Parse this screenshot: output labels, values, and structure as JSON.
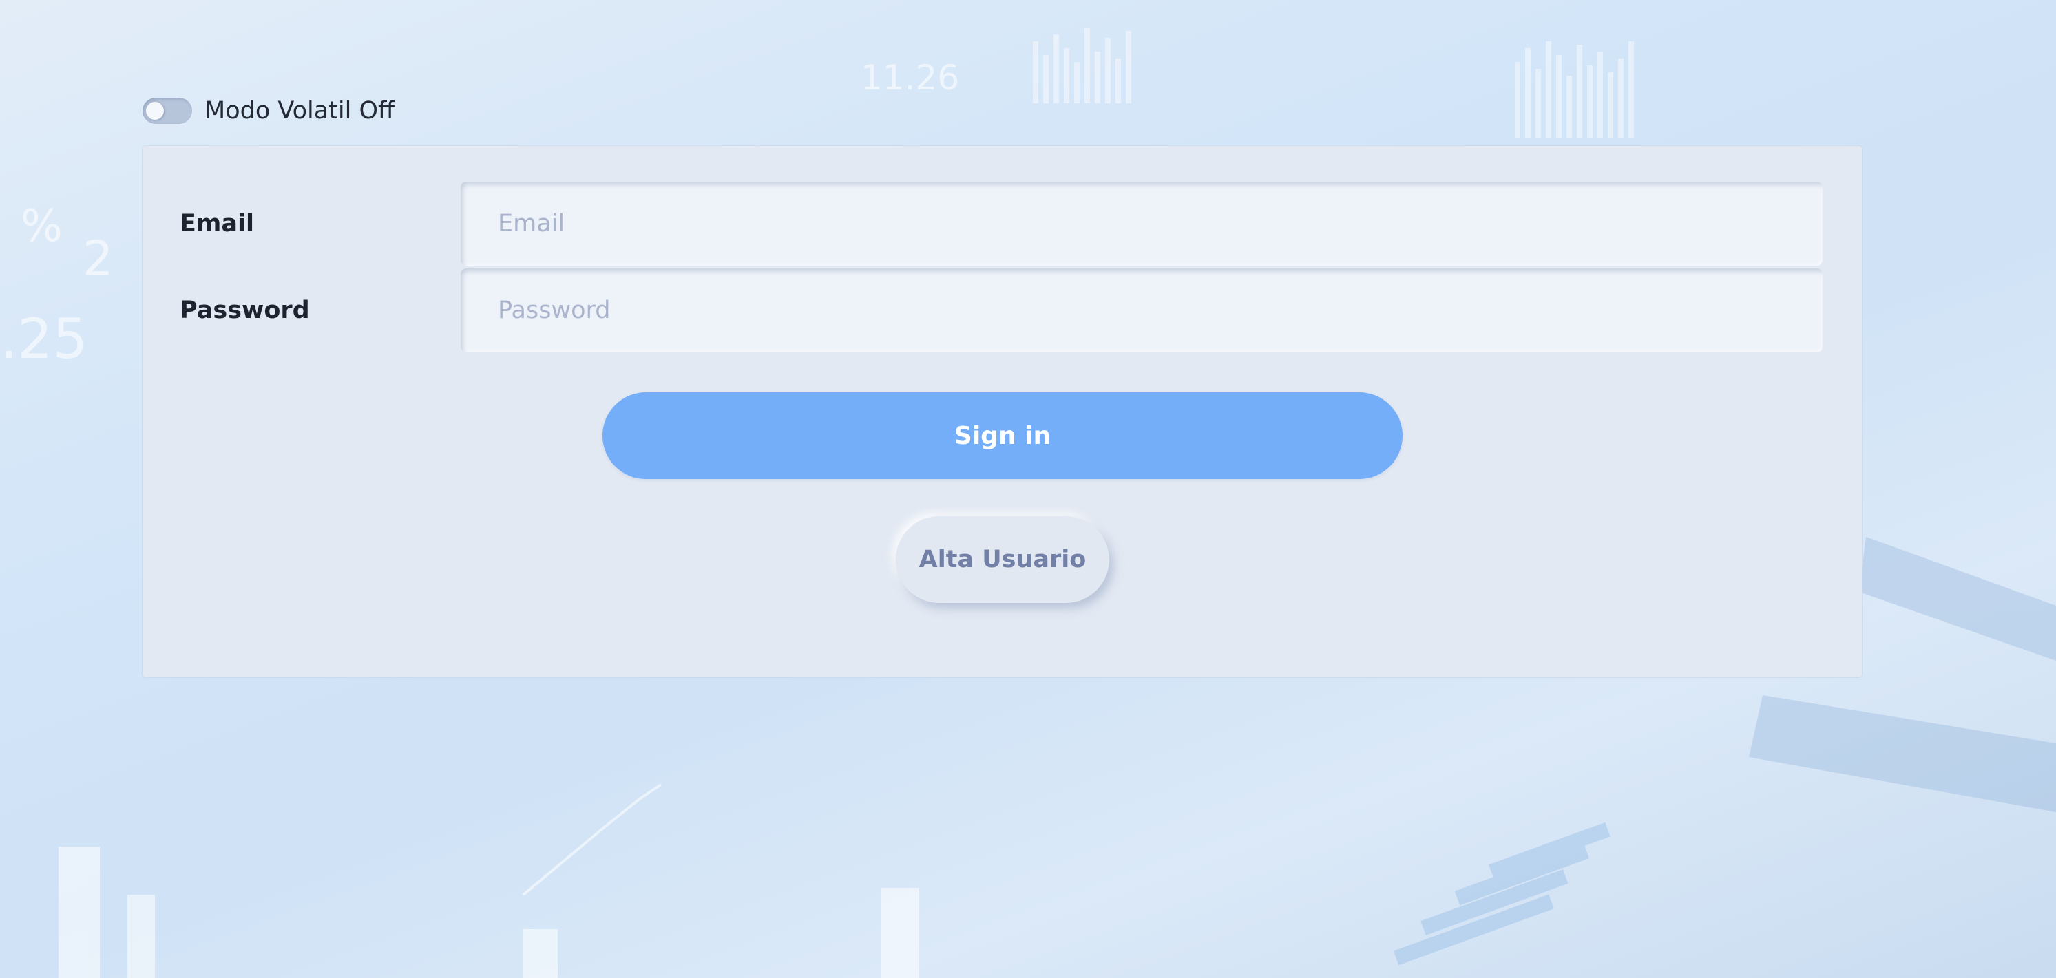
{
  "toggle": {
    "label": "Modo Volatil Off",
    "state": "off"
  },
  "form": {
    "email": {
      "label": "Email",
      "placeholder": "Email",
      "value": ""
    },
    "password": {
      "label": "Password",
      "placeholder": "Password",
      "value": ""
    },
    "signin_label": "Sign in",
    "alta_label": "Alta Usuario"
  },
  "colors": {
    "primary_button": "#74adf8",
    "card_background": "#e3e9f3",
    "secondary_button_text": "#7280a8"
  }
}
